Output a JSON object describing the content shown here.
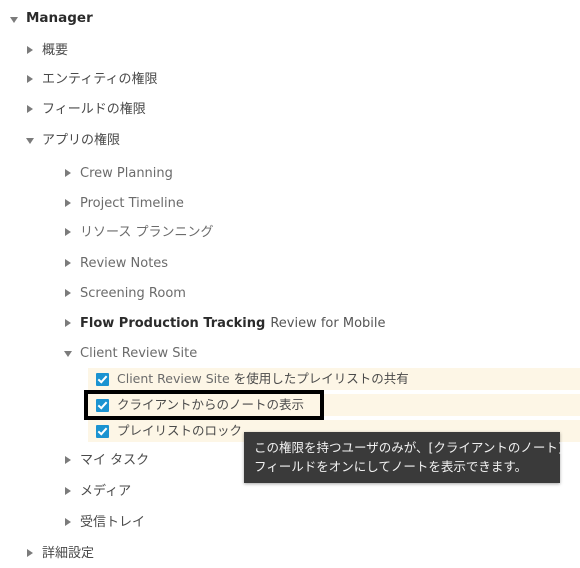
{
  "tree": {
    "root": {
      "label": "Manager",
      "twisty": "expanded"
    },
    "sections": [
      {
        "label": "概要",
        "twisty": "collapsed"
      },
      {
        "label": "エンティティの権限",
        "twisty": "collapsed"
      },
      {
        "label": "フィールドの権限",
        "twisty": "collapsed"
      },
      {
        "label": "アプリの権限",
        "twisty": "expanded"
      }
    ],
    "apps": [
      {
        "label": "Crew Planning",
        "twisty": "collapsed",
        "strong": false,
        "suffix": ""
      },
      {
        "label": "Project Timeline",
        "twisty": "collapsed",
        "strong": false,
        "suffix": ""
      },
      {
        "label": "リソース プランニング",
        "twisty": "collapsed",
        "strong": false,
        "suffix": ""
      },
      {
        "label": "Review Notes",
        "twisty": "collapsed",
        "strong": false,
        "suffix": ""
      },
      {
        "label": "Screening Room",
        "twisty": "collapsed",
        "strong": false,
        "suffix": ""
      },
      {
        "label": "Flow Production Tracking",
        "twisty": "collapsed",
        "strong": true,
        "suffix": "Review for Mobile"
      },
      {
        "label": "Client Review Site",
        "twisty": "expanded",
        "strong": false,
        "suffix": ""
      }
    ],
    "permissions": [
      {
        "checked": true,
        "prefix": "Client Review Site",
        "label": "を使用したプレイリストの共有"
      },
      {
        "checked": true,
        "prefix": "",
        "label": "クライアントからのノートの表示"
      },
      {
        "checked": true,
        "prefix": "",
        "label": "プレイリストのロック"
      }
    ],
    "apps_tail": [
      {
        "label": "マイ タスク",
        "twisty": "collapsed"
      },
      {
        "label": "メディア",
        "twisty": "collapsed"
      },
      {
        "label": "受信トレイ",
        "twisty": "collapsed"
      }
    ],
    "sections_tail": [
      {
        "label": "詳細設定",
        "twisty": "collapsed"
      }
    ]
  },
  "tooltip": {
    "line1": "この権限を持つユーザのみが、[クライアントのノート]",
    "line2": "フィールドをオンにしてノートを表示できます。"
  },
  "colors": {
    "row_highlight": "#fdf6e6",
    "checkbox": "#1b93d1",
    "tooltip_bg": "#3a3a3a",
    "focus_border": "#000000",
    "text": "#4a4a4a",
    "text_muted": "#6b6b6b",
    "text_strong": "#2b2b2b"
  }
}
